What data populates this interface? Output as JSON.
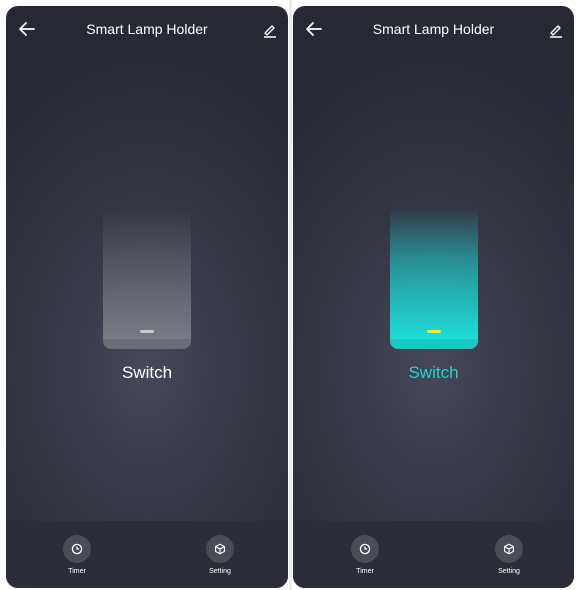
{
  "app": {
    "title": "Smart Lamp Holder"
  },
  "screens": [
    {
      "state": "off",
      "switch_label": "Switch",
      "actions": [
        {
          "label": "Timer",
          "icon": "clock-icon"
        },
        {
          "label": "Setting",
          "icon": "settings-cube-icon"
        }
      ]
    },
    {
      "state": "on",
      "switch_label": "Switch",
      "actions": [
        {
          "label": "Timer",
          "icon": "clock-icon"
        },
        {
          "label": "Setting",
          "icon": "settings-cube-icon"
        }
      ]
    }
  ],
  "colors": {
    "background": "#343643",
    "accent_on": "#1ce0db",
    "indicator_on": "#e6f03a",
    "switch_off": "#7a7c86"
  }
}
